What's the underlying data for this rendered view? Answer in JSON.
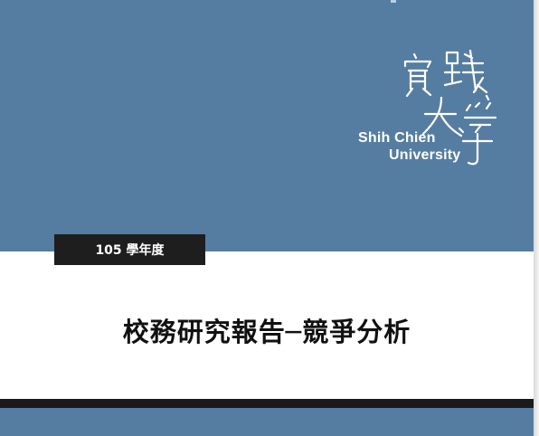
{
  "logo": {
    "name_en_line1": "Shih Chien",
    "name_en_line2": "University",
    "name_zh": "實踐大學"
  },
  "cover": {
    "year_label": "105 學年度",
    "title": "校務研究報告─競爭分析"
  },
  "colors": {
    "band_blue": "#557da1",
    "dark": "#1e1e1e",
    "paper": "#ffffff"
  }
}
